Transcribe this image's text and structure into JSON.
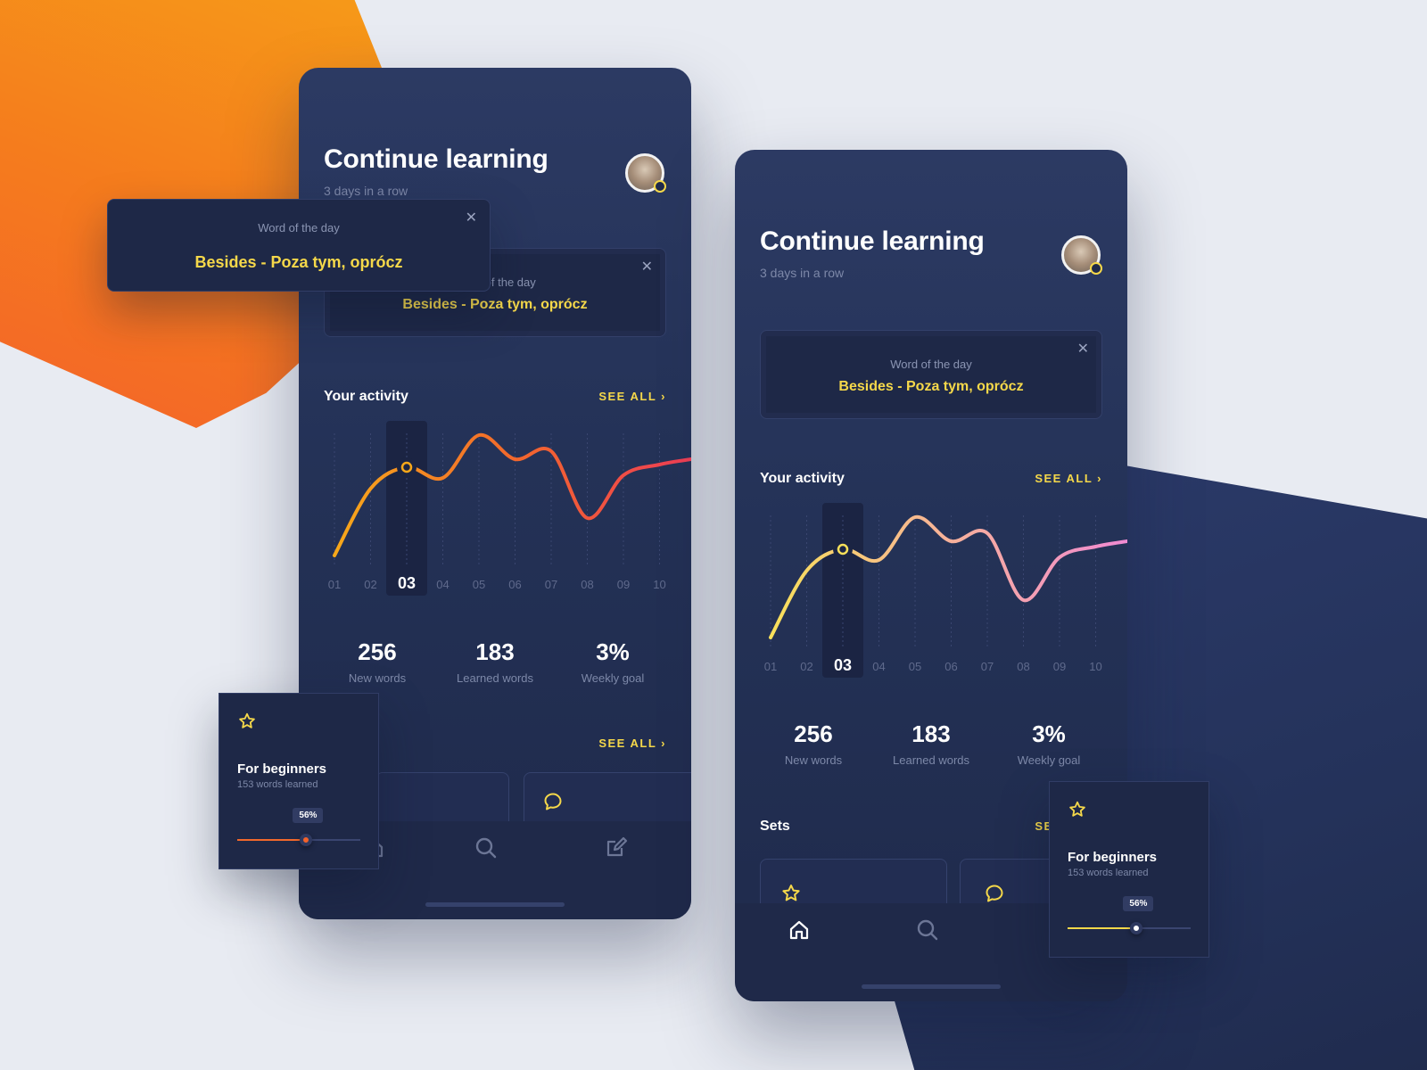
{
  "screen": {
    "title": "Continue learning",
    "subtitle": "3 days in a row",
    "word_of_day": {
      "label": "Word of the day",
      "word": "Besides - Poza tym, oprócz"
    },
    "activity": {
      "title": "Your activity",
      "see_all": "SEE ALL",
      "selected_day": "03"
    },
    "stats": [
      {
        "value": "256",
        "label": "New words"
      },
      {
        "value": "183",
        "label": "Learned words"
      },
      {
        "value": "3%",
        "label": "Weekly goal"
      }
    ],
    "sets": {
      "title": "Sets",
      "see_all": "SEE ALL"
    },
    "set_card": {
      "title": "For beginners",
      "subtitle": "153 words learned",
      "progress_label": "56%",
      "progress": 0.56
    },
    "nav": [
      "home-icon",
      "search-icon",
      "edit-icon"
    ]
  },
  "colors": {
    "accent": "#f5d84a",
    "left_gradient": [
      "#f7a81a",
      "#f2682c",
      "#ee3e55"
    ],
    "right_gradient": [
      "#f8e05a",
      "#f7b19a",
      "#f08ad2"
    ]
  },
  "chart_data": {
    "type": "line",
    "x": [
      "01",
      "02",
      "03",
      "04",
      "05",
      "06",
      "07",
      "08",
      "09",
      "10"
    ],
    "series": [
      {
        "values": [
          2,
          52,
          68,
          60,
          92,
          74,
          80,
          30,
          62,
          70
        ]
      }
    ],
    "selected_index": 2,
    "grid": true
  }
}
